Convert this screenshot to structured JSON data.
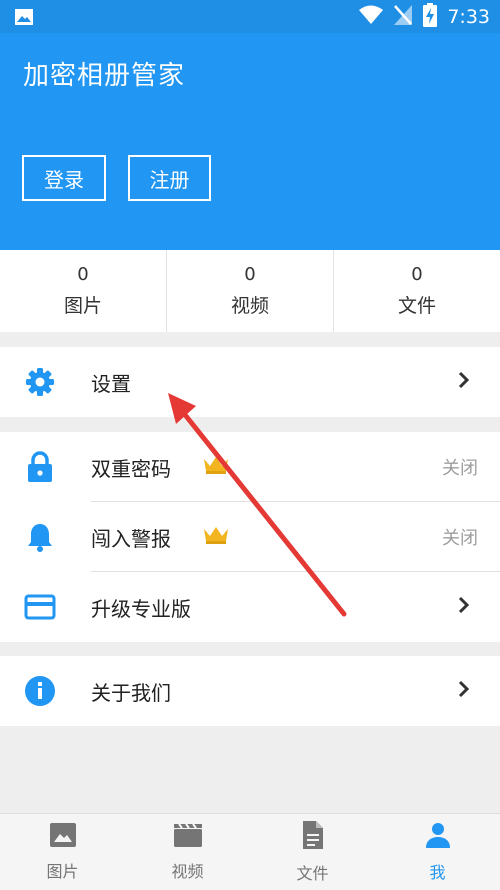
{
  "status_bar": {
    "time": "7:33"
  },
  "header": {
    "app_title": "加密相册管家",
    "login_label": "登录",
    "register_label": "注册"
  },
  "stats": [
    {
      "count": "0",
      "label": "图片"
    },
    {
      "count": "0",
      "label": "视频"
    },
    {
      "count": "0",
      "label": "文件"
    }
  ],
  "menu": {
    "settings": {
      "label": "设置"
    },
    "double_password": {
      "label": "双重密码",
      "status": "关闭"
    },
    "intrusion_alert": {
      "label": "闯入警报",
      "status": "关闭"
    },
    "upgrade": {
      "label": "升级专业版"
    },
    "about": {
      "label": "关于我们"
    }
  },
  "tabs": [
    {
      "label": "图片",
      "icon": "image-icon",
      "active": false
    },
    {
      "label": "视频",
      "icon": "video-icon",
      "active": false
    },
    {
      "label": "文件",
      "icon": "file-icon",
      "active": false
    },
    {
      "label": "我",
      "icon": "person-icon",
      "active": true
    }
  ],
  "colors": {
    "primary": "#2196f3",
    "status_bar": "#1f8fe6",
    "background": "#eeeeee",
    "crown": "#f2b41f",
    "annotation_arrow": "#e53935"
  }
}
